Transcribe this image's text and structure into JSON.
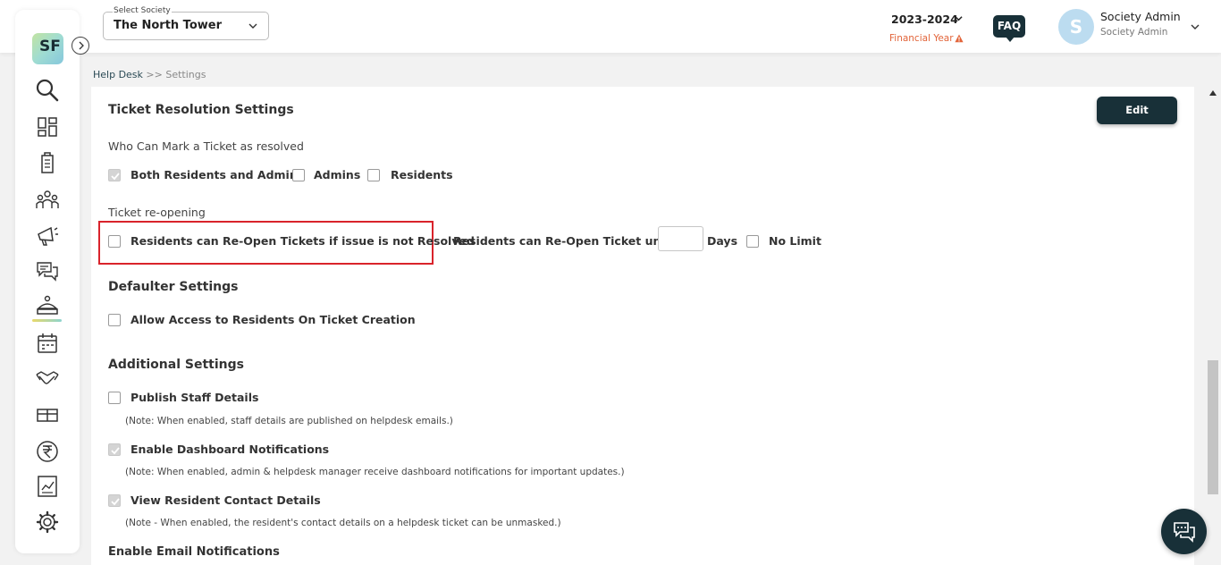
{
  "header": {
    "society_select": {
      "label": "Select Society",
      "value": "The North Tower"
    },
    "financial_year": {
      "value": "2023-2024",
      "label": "Financial Year"
    },
    "faq_label": "FAQ",
    "user": {
      "initial": "S",
      "name": "Society Admin",
      "role": "Society Admin"
    }
  },
  "sidebar": {
    "logo_text": "SF",
    "items": [
      {
        "icon": "search-icon"
      },
      {
        "icon": "dashboard-icon"
      },
      {
        "icon": "building-icon"
      },
      {
        "icon": "residents-icon"
      },
      {
        "icon": "announcement-icon"
      },
      {
        "icon": "chat-bubbles-icon"
      },
      {
        "icon": "helpdesk-icon",
        "active": true
      },
      {
        "icon": "calendar-icon"
      },
      {
        "icon": "handshake-icon"
      },
      {
        "icon": "amenities-icon"
      },
      {
        "icon": "rupee-icon"
      },
      {
        "icon": "reports-icon"
      },
      {
        "icon": "settings-icon"
      }
    ]
  },
  "breadcrumb": {
    "parent": "Help Desk",
    "separator": ">>",
    "current": "Settings"
  },
  "ticket_resolution": {
    "title": "Ticket Resolution Settings",
    "edit_label": "Edit",
    "who_can_resolve_label": "Who Can Mark a Ticket as resolved",
    "options": [
      {
        "label": "Both Residents and Admins",
        "checked": true
      },
      {
        "label": "Admins",
        "checked": false
      },
      {
        "label": "Residents",
        "checked": false
      }
    ],
    "reopening_label": "Ticket re-opening",
    "reopen_option": {
      "label": "Residents can Re-Open Tickets if issue is not Resolved",
      "checked": false
    },
    "reopen_until_label": "Residents can Re-Open Ticket until",
    "reopen_days_value": "",
    "days_label": "Days",
    "no_limit": {
      "label": "No Limit",
      "checked": false
    }
  },
  "defaulter": {
    "title": "Defaulter Settings",
    "option": {
      "label": "Allow Access to Residents On Ticket Creation",
      "checked": false
    }
  },
  "additional": {
    "title": "Additional Settings",
    "items": [
      {
        "label": "Publish Staff Details",
        "checked": false,
        "note": "(Note: When enabled, staff details are published on helpdesk emails.)"
      },
      {
        "label": "Enable Dashboard Notifications",
        "checked": true,
        "note": "(Note: When enabled, admin & helpdesk manager receive dashboard notifications for important updates.)"
      },
      {
        "label": "View Resident Contact Details",
        "checked": true,
        "note": "(Note - When enabled, the resident's contact details on a helpdesk ticket can be unmasked.)"
      }
    ]
  },
  "email_notifications": {
    "title": "Enable Email Notifications"
  },
  "colors": {
    "primary": "#183038",
    "warning": "#e2643a",
    "highlight": "#d9232b"
  }
}
